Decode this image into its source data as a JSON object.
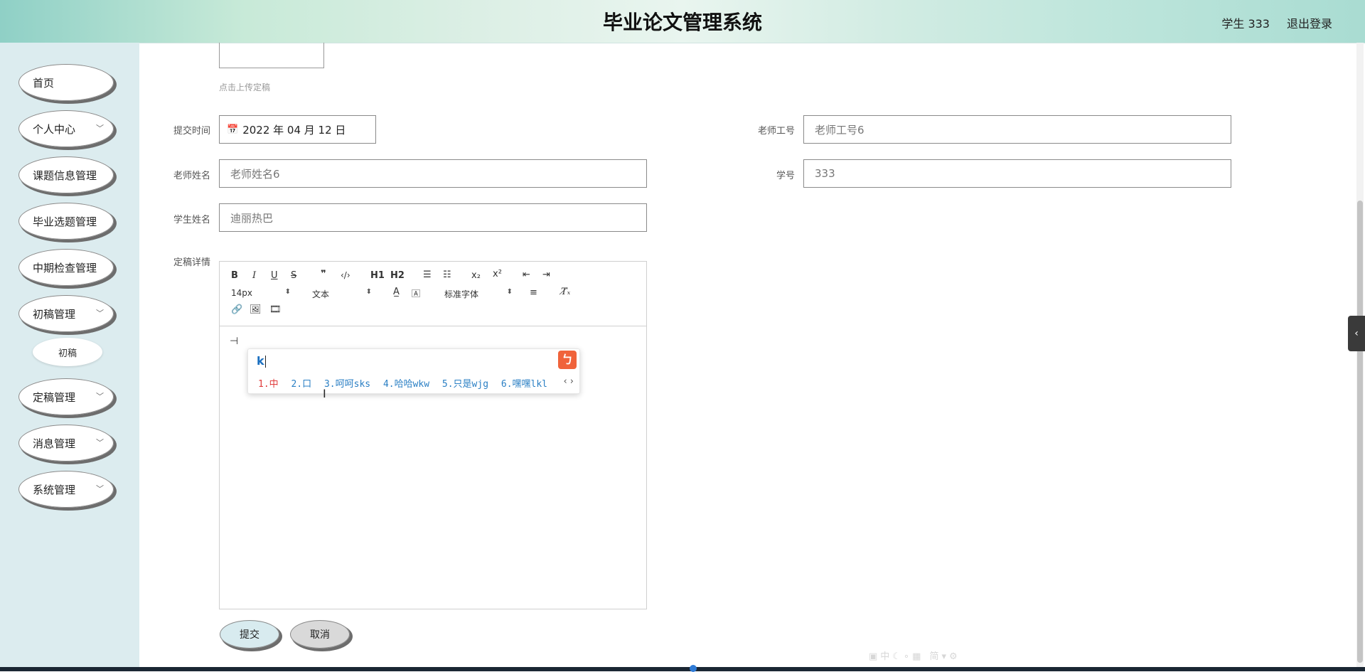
{
  "header": {
    "title": "毕业论文管理系统",
    "user": "学生 333",
    "logout": "退出登录"
  },
  "sidebar": {
    "items": [
      {
        "label": "首页",
        "has_children": false
      },
      {
        "label": "个人中心",
        "has_children": true
      },
      {
        "label": "课题信息管理",
        "has_children": false
      },
      {
        "label": "毕业选题管理",
        "has_children": false
      },
      {
        "label": "中期检查管理",
        "has_children": false
      },
      {
        "label": "初稿管理",
        "has_children": true
      },
      {
        "label": "定稿管理",
        "has_children": true
      },
      {
        "label": "消息管理",
        "has_children": true
      },
      {
        "label": "系统管理",
        "has_children": true
      }
    ],
    "sub_item": "初稿"
  },
  "form": {
    "upload_hint": "点击上传定稿",
    "submit_time_label": "提交时间",
    "submit_time_value": "2022 年 04 月 12 日",
    "teacher_id_label": "老师工号",
    "teacher_id_value": "老师工号6",
    "teacher_name_label": "老师姓名",
    "teacher_name_value": "老师姓名6",
    "student_no_label": "学号",
    "student_no_value": "333",
    "student_name_label": "学生姓名",
    "student_name_value": "迪丽热巴",
    "detail_label": "定稿详情"
  },
  "editor": {
    "font_size": "14px",
    "text_type": "文本",
    "font_family": "标准字体",
    "h1": "H1",
    "h2": "H2"
  },
  "ime": {
    "input": "k",
    "candidates": [
      "1.中",
      "2.口",
      "3.呵呵sks",
      "4.哈哈wkw",
      "5.只是wjg",
      "6.嘿嘿lkl"
    ]
  },
  "buttons": {
    "submit": "提交",
    "cancel": "取消"
  },
  "colors": {
    "sidebar_bg": "#dcecef",
    "ime_logo": "#f0633b",
    "candidate_first": "#e03c3c",
    "candidate": "#2a7fc4"
  }
}
